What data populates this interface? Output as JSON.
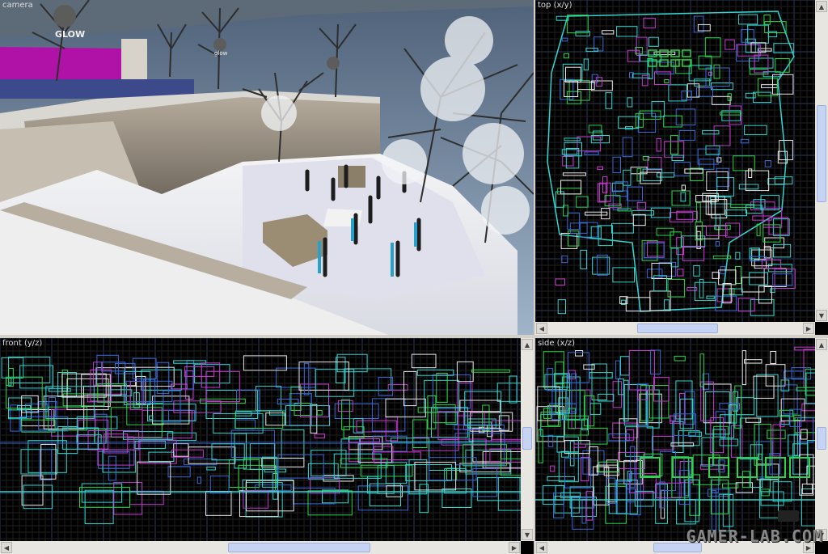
{
  "viewports": {
    "camera": {
      "label": "camera"
    },
    "top": {
      "label": "top (x/y)"
    },
    "front": {
      "label": "front (y/z)"
    },
    "side": {
      "label": "side (x/z)"
    }
  },
  "camera_scene": {
    "sign_text": "GLOW",
    "lamp_text": "glow"
  },
  "watermark": "GAMER-LAB.COM",
  "colors": {
    "grid": "#1f1f1f",
    "grid_major": "#2d3a5a",
    "brush_green": "#2bd44a",
    "brush_cyan": "#34d6d0",
    "brush_blue": "#3a6ad8",
    "brush_magenta": "#c83ad0",
    "brush_white": "#e8e8e8"
  },
  "scroll_arrows": {
    "up": "▲",
    "down": "▼",
    "left": "◀",
    "right": "▶"
  }
}
